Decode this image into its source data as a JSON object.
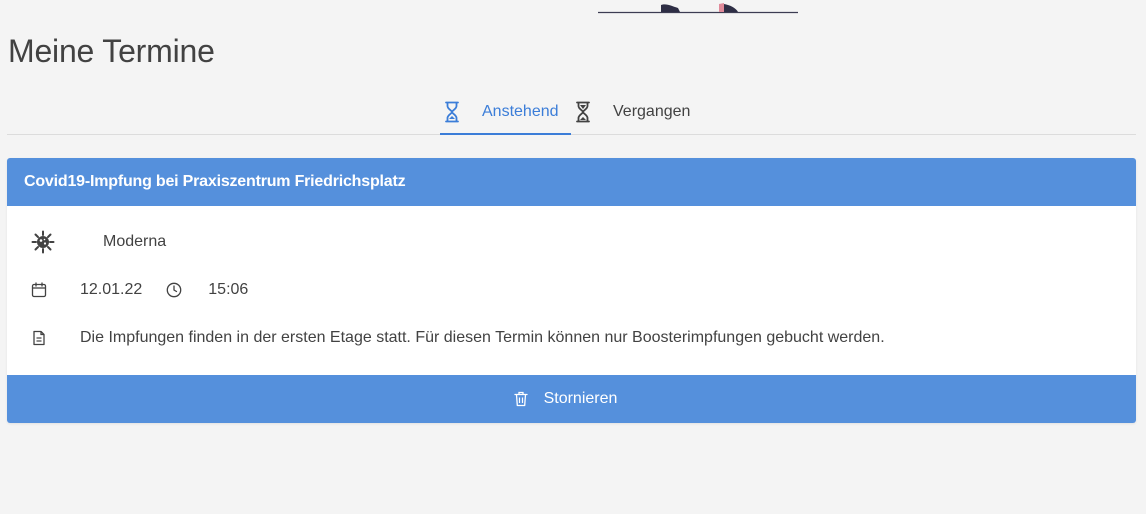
{
  "page": {
    "title": "Meine Termine"
  },
  "tabs": [
    {
      "label": "Anstehend",
      "icon": "hourglass-icon",
      "active": true
    },
    {
      "label": "Vergangen",
      "icon": "hourglass-icon",
      "active": false
    }
  ],
  "appointment": {
    "title": "Covid19-Impfung bei Praxiszentrum Friedrichsplatz",
    "vaccine": "Moderna",
    "date": "12.01.22",
    "time": "15:06",
    "note": "Die Impfungen finden in der ersten Etage statt. Für diesen Termin können nur Boosterimpfungen gebucht werden.",
    "cancel_label": "Stornieren"
  },
  "colors": {
    "accent": "#3b7dd8",
    "card_header": "#5590dc",
    "background": "#f4f4f4",
    "text": "#424242"
  }
}
